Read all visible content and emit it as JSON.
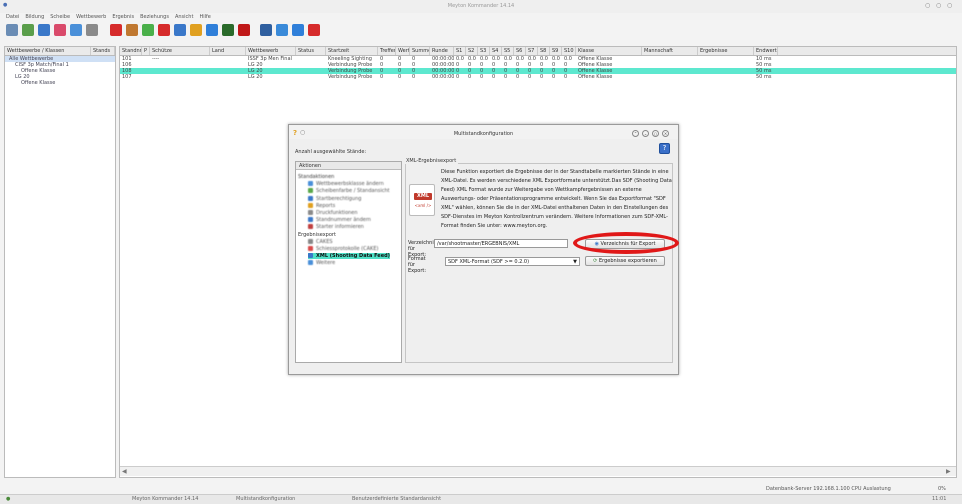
{
  "window": {
    "title": "Meyton Kommander 14.14",
    "win_buttons": [
      "○",
      "○",
      "○"
    ]
  },
  "menu": [
    "Datei",
    "Bildung",
    "Scheibe",
    "Wettbewerb",
    "Ergebnis",
    "Beziehungs",
    "Ansicht",
    "Hilfe"
  ],
  "toolbar": {
    "icons": [
      {
        "name": "new-icon",
        "color": "#6b8db5"
      },
      {
        "name": "edit-icon",
        "color": "#5a9e4b"
      },
      {
        "name": "refresh-icon",
        "color": "#3a78c9"
      },
      {
        "name": "heart-icon",
        "color": "#d94a6a"
      },
      {
        "name": "clock-icon",
        "color": "#4a90d9"
      },
      {
        "name": "square-icon",
        "color": "#8a8a8a"
      },
      {
        "name": "delete-icon",
        "color": "#d62b2b"
      },
      {
        "name": "group-icon",
        "color": "#c07830"
      },
      {
        "name": "user-icon",
        "color": "#4ab04a"
      },
      {
        "name": "target-icon",
        "color": "#d62b2b"
      },
      {
        "name": "settings-icon",
        "color": "#3a78c9"
      },
      {
        "name": "lock-icon",
        "color": "#e0a020"
      },
      {
        "name": "chart-icon",
        "color": "#2f7fd9"
      },
      {
        "name": "grid-icon",
        "color": "#2b6b2b"
      },
      {
        "name": "stop-icon",
        "color": "#c01818"
      },
      {
        "name": "monitor-icon",
        "color": "#2f5f9f"
      },
      {
        "name": "search-icon",
        "color": "#3a8ad9"
      },
      {
        "name": "info-icon",
        "color": "#2f7fd9"
      },
      {
        "name": "close-icon",
        "color": "#d62b2b"
      }
    ]
  },
  "tree": {
    "headers": [
      "Wettbewerbe / Klassen",
      "Stands"
    ],
    "items": [
      {
        "label": "Alle Wettbewerbe",
        "indent": 0,
        "selected": true
      },
      {
        "label": "CISF 3p Match/Final 1",
        "indent": 1
      },
      {
        "label": "Offene Klasse",
        "indent": 2
      },
      {
        "label": "LG 20",
        "indent": 1
      },
      {
        "label": "Offene Klasse",
        "indent": 2
      }
    ]
  },
  "grid": {
    "headers": [
      "Standnr",
      "P",
      "Schütze",
      "Land",
      "Wettbewerb",
      "Status",
      "Startzeit",
      "Treffer",
      "Wert",
      "Summe",
      "Runde",
      "S1",
      "S2",
      "S3",
      "S4",
      "S5",
      "S6",
      "S7",
      "S8",
      "S9",
      "S10",
      "Klasse",
      "Mannschaft",
      "Ergebnisse",
      "Endwert"
    ],
    "rows": [
      [
        "101",
        "",
        "----",
        "",
        "ISSF 3p Men Final",
        "",
        "Kneeling Sighting",
        "0",
        "0",
        "0",
        "00:00:00",
        "0.0",
        "0.0",
        "0.0",
        "0.0",
        "0.0",
        "0.0",
        "0.0",
        "0.0",
        "0.0",
        "0.0",
        "Offene Klasse",
        "",
        "",
        "10 ms"
      ],
      [
        "106",
        "",
        "",
        "",
        "LG 20",
        "",
        "Verbindung Probe",
        "0",
        "0",
        "0",
        "00:00:00",
        "0",
        "0",
        "0",
        "0",
        "0",
        "0",
        "0",
        "0",
        "0",
        "0",
        "Offene Klasse",
        "",
        "",
        "50 ms"
      ],
      [
        "108",
        "",
        "",
        "",
        "LG 20",
        "",
        "Verbindung Probe",
        "0",
        "0",
        "0",
        "00:00:00",
        "0",
        "0",
        "0",
        "0",
        "0",
        "0",
        "0",
        "0",
        "0",
        "0",
        "Offene Klasse",
        "",
        "",
        "50 ms"
      ],
      [
        "107",
        "",
        "",
        "",
        "LG 20",
        "",
        "Verbindung Probe",
        "0",
        "0",
        "0",
        "00:00:00",
        "0",
        "0",
        "0",
        "0",
        "0",
        "0",
        "0",
        "0",
        "0",
        "0",
        "Offene Klasse",
        "",
        "",
        "50 ms"
      ]
    ],
    "selected_row": 2
  },
  "status": {
    "server": "Datenbank-Server 192.168.1.100 CPU Auslastung",
    "load": "0%",
    "time": "11:01"
  },
  "taskbar": {
    "items": [
      "Meyton Kommander 14.14",
      "Multistandkonfiguration",
      "Benutzerdefinierte Standardansicht"
    ]
  },
  "dialog": {
    "title": "Multistandkonfiguration",
    "stands_label": "Anzahl ausgewählte Stände:",
    "actions_header": "Aktionen",
    "actions": [
      {
        "label": "Standaktionen",
        "type": "group",
        "blur": true
      },
      {
        "label": "Wettbewerbsklasse ändern",
        "color": "#4a90d9",
        "blur": true
      },
      {
        "label": "Scheibenfarbe / Standansicht",
        "color": "#5aa84a",
        "blur": true
      },
      {
        "label": "Startberechtigung",
        "color": "#3a78c9",
        "blur": true
      },
      {
        "label": "Reports",
        "color": "#e0a020",
        "blur": true
      },
      {
        "label": "Druckfunktionen",
        "color": "#8a8a8a",
        "blur": true
      },
      {
        "label": "Standnummer ändern",
        "color": "#3a78c9",
        "blur": true
      },
      {
        "label": "Starter informieren",
        "color": "#c04040",
        "blur": true
      },
      {
        "label": "Ergebnisexport",
        "type": "group"
      },
      {
        "label": "CAKES",
        "color": "#888888",
        "blur": true
      },
      {
        "label": "Schiessprotokolle (CAKE)",
        "color": "#d94a4a",
        "blur": true
      },
      {
        "label": "XML (Shooting Data Feed)",
        "color": "#3a78c9",
        "selected": true
      },
      {
        "label": "Weitere",
        "color": "#4a90d9",
        "blur": true
      }
    ],
    "xml_legend": "XML-Ergebnisexport",
    "xml_icon_badge": "XML",
    "xml_icon_tag": "<xml />",
    "description": "Diese Funktion exportiert die Ergebnisse der in der Standtabelle markierten Stände in eine XML-Datei. Es werden verschiedene XML Exportformate unterstützt.Das SDF (Shooting Data Feed) XML Format wurde zur Weitergabe von Wettkampfergebnissen an externe Auswertungs- oder Präsentationsprogramme entwickelt. Wenn Sie das Exportformat \"SDF XML\" wählen, können Sie die in der XML-Datei enthaltenen Daten in den Einstellungen des SDF-Dienstes im Meyton Kontrollzentrum verändern. Weitere Informationen zum SDF-XML-Format finden Sie unter: www.meyton.org.",
    "dir_label": "Verzeichnis für Export:",
    "dir_value": "/var/shootmaster/ERGEBNIS/XML",
    "dir_button": "Verzeichnis für Export",
    "format_label": "Format für Export:",
    "format_value": "SDF XML-Format (SDF >= 0.2.0)",
    "export_button": "Ergebnisse exportieren",
    "help_glyph": "?",
    "dlg_buttons": [
      "⌃",
      "⌄",
      "○",
      "×"
    ],
    "title_icons": [
      "?",
      "○"
    ]
  }
}
